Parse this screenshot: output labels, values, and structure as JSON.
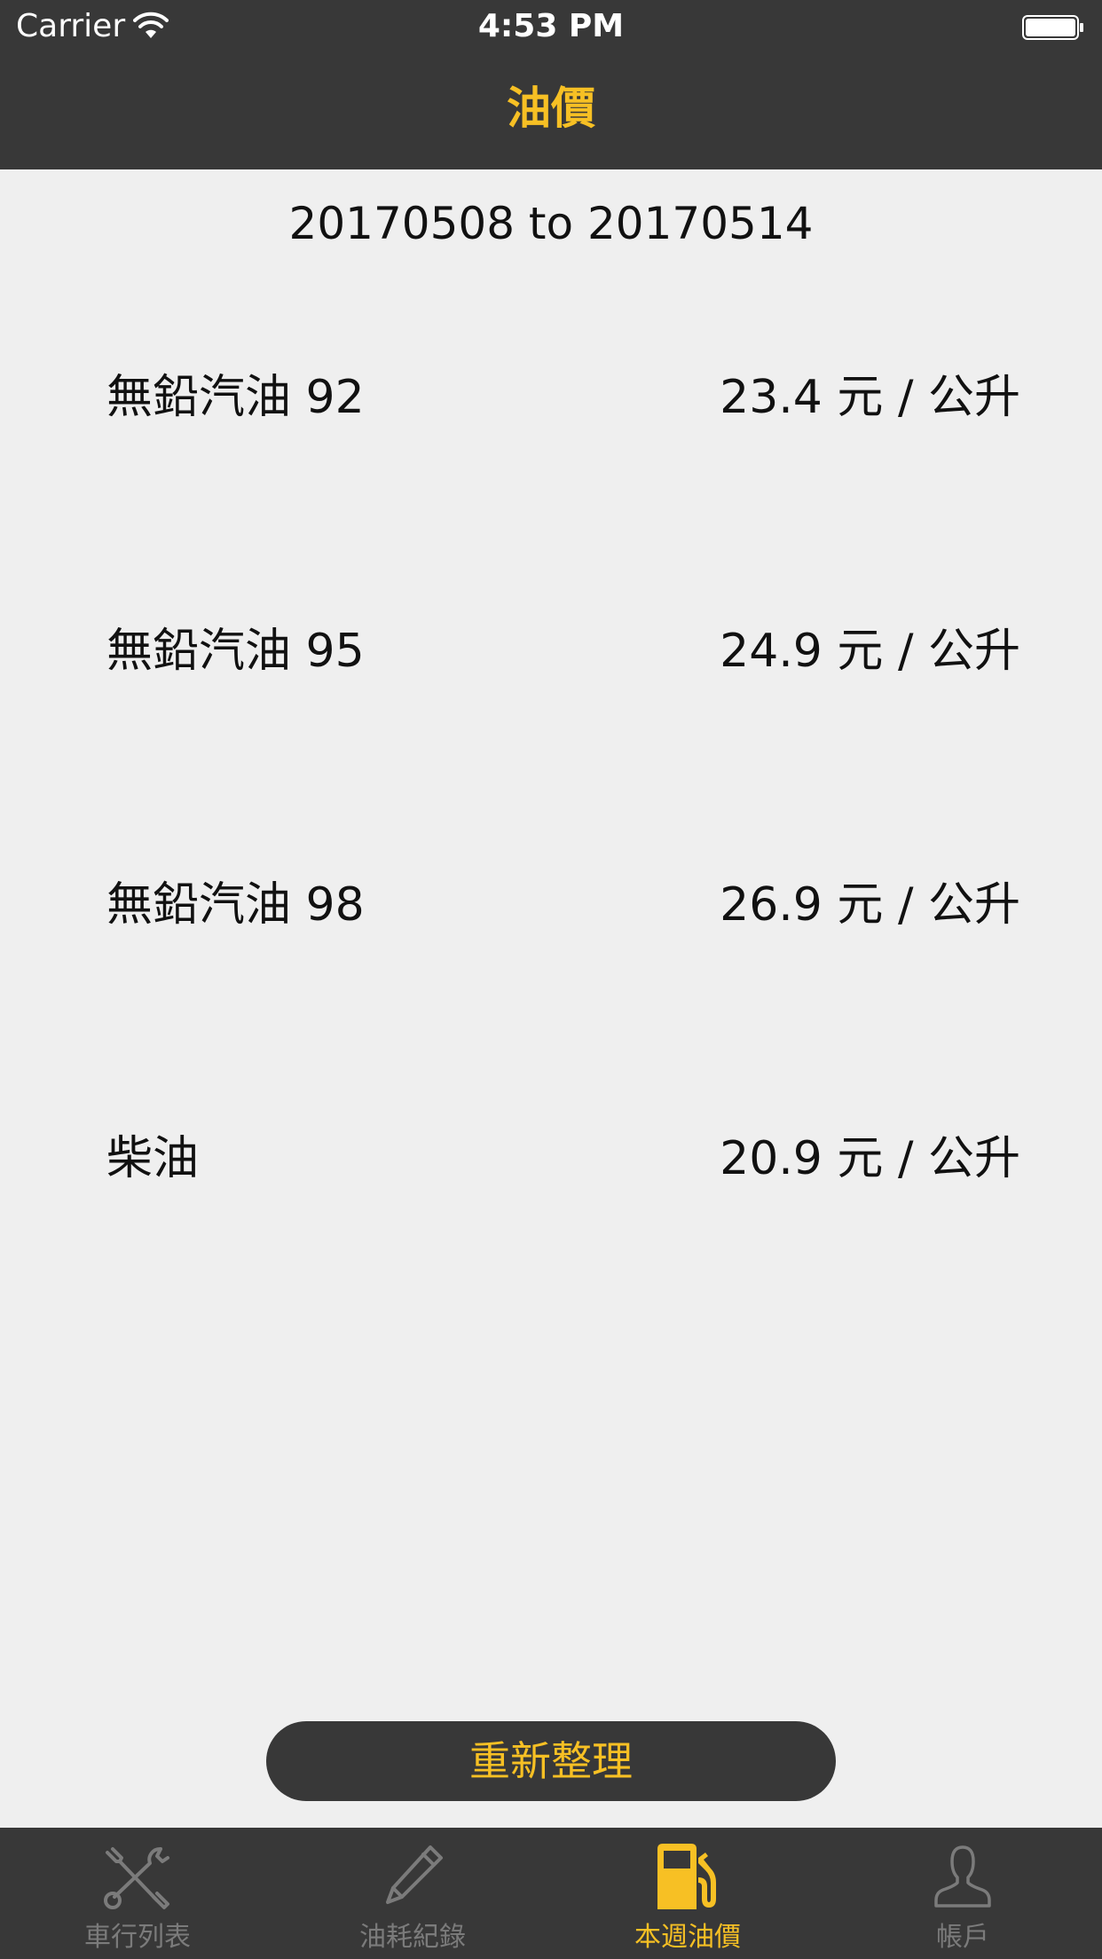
{
  "status_bar": {
    "carrier": "Carrier",
    "time": "4:53 PM"
  },
  "nav": {
    "title": "油價"
  },
  "date_range": "20170508 to 20170514",
  "prices": [
    {
      "name": "無鉛汽油 92",
      "price": "23.4 元 / 公升"
    },
    {
      "name": "無鉛汽油 95",
      "price": "24.9 元 / 公升"
    },
    {
      "name": "無鉛汽油 98",
      "price": "26.9 元 / 公升"
    },
    {
      "name": "柴油",
      "price": "20.9 元 / 公升"
    }
  ],
  "refresh_button": "重新整理",
  "tabs": [
    {
      "label": "車行列表",
      "icon": "tools-icon",
      "active": false
    },
    {
      "label": "油耗紀錄",
      "icon": "pencil-icon",
      "active": false
    },
    {
      "label": "本週油價",
      "icon": "fuel-pump-icon",
      "active": true
    },
    {
      "label": "帳戶",
      "icon": "person-icon",
      "active": false
    }
  ],
  "colors": {
    "accent": "#f7c024",
    "bar_background": "#383838",
    "page_background": "#efefef",
    "inactive_tab": "#7b7b7b"
  }
}
